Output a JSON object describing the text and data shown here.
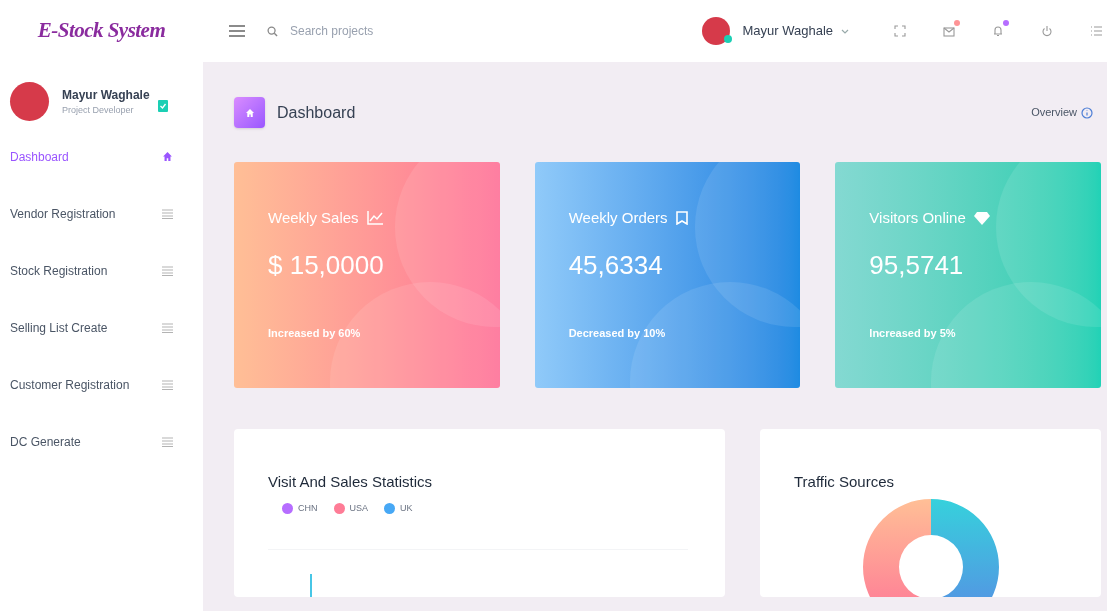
{
  "brand": "E-Stock System",
  "search": {
    "placeholder": "Search projects"
  },
  "header_user": {
    "name": "Mayur Waghale",
    "online": true
  },
  "header_icons": [
    {
      "kind": "fullscreen"
    },
    {
      "kind": "mail",
      "color": "#fe9496"
    },
    {
      "kind": "bell",
      "color": "#b66dff"
    },
    {
      "kind": "power"
    },
    {
      "kind": "list"
    }
  ],
  "profile": {
    "name": "Mayur Waghale",
    "role": "Project Developer",
    "verified": true
  },
  "sidebar": {
    "items": [
      {
        "label": "Dashboard",
        "selected": true
      },
      {
        "label": "Vendor Registration",
        "selected": false
      },
      {
        "label": "Stock Registration",
        "selected": false
      },
      {
        "label": "Selling List Create",
        "selected": false
      },
      {
        "label": "Customer Registration",
        "selected": false
      },
      {
        "label": "DC Generate",
        "selected": false
      }
    ]
  },
  "page": {
    "title": "Dashboard",
    "overview": "Overview"
  },
  "stats": [
    {
      "kind": "sales",
      "title": "Weekly Sales",
      "value": "$ 15,0000",
      "note": "Increased by 60%"
    },
    {
      "kind": "orders",
      "title": "Weekly Orders",
      "value": "45,6334",
      "note": "Decreased by 10%"
    },
    {
      "kind": "visitors",
      "title": "Visitors Online",
      "value": "95,5741",
      "note": "Increased by 5%"
    }
  ],
  "visit_stats": {
    "title": "Visit And Sales Statistics",
    "legend": [
      {
        "label": "CHN",
        "color": "#b66dff"
      },
      {
        "label": "USA",
        "color": "#fe7c96"
      },
      {
        "label": "UK",
        "color": "#47a8f5"
      }
    ]
  },
  "traffic": {
    "title": "Traffic Sources"
  }
}
